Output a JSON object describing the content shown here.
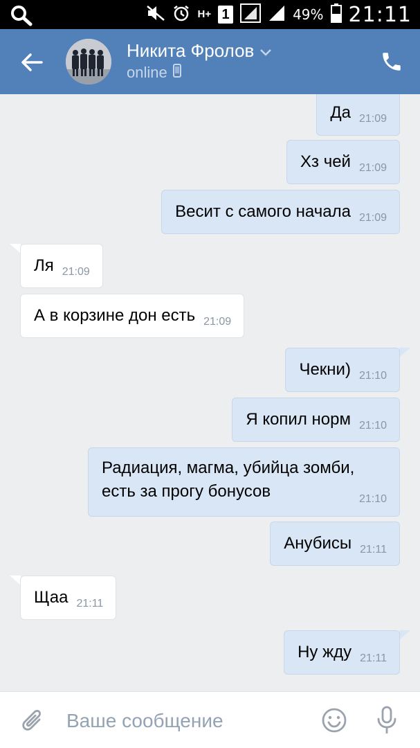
{
  "status_bar": {
    "network": "H+",
    "sim_badge": "1",
    "battery_percent": "49%",
    "time": "21:11"
  },
  "header": {
    "contact_name": "Никита Фролов",
    "status": "online",
    "colors": {
      "bar": "#5181b8",
      "status_text": "#c6d6ea"
    }
  },
  "messages": [
    {
      "dir": "out",
      "text": "Да",
      "time": "21:09"
    },
    {
      "dir": "out",
      "text": "Хз чей",
      "time": "21:09"
    },
    {
      "dir": "out",
      "text": "Весит с самого начала",
      "time": "21:09"
    },
    {
      "dir": "in",
      "text": "Ля",
      "time": "21:09"
    },
    {
      "dir": "in",
      "text": "А в корзине дон есть",
      "time": "21:09"
    },
    {
      "dir": "out",
      "text": "Чекни)",
      "time": "21:10"
    },
    {
      "dir": "out",
      "text": "Я копил норм",
      "time": "21:10"
    },
    {
      "dir": "out",
      "text_lines": [
        "Радиация, магма, убийца зомби,",
        "есть за прогу бонусов"
      ],
      "time": "21:10"
    },
    {
      "dir": "out",
      "text": "Анубисы",
      "time": "21:11"
    },
    {
      "dir": "in",
      "text": "Щаа",
      "time": "21:11"
    },
    {
      "dir": "out",
      "text": "Ну жду",
      "time": "21:11"
    }
  ],
  "composer": {
    "placeholder": "Ваше сообщение"
  },
  "icons": {
    "status_search": "search-icon",
    "back": "arrow-left-icon",
    "call": "phone-icon",
    "attach": "paperclip-icon",
    "emoji": "smiley-icon",
    "voice": "microphone-icon"
  }
}
